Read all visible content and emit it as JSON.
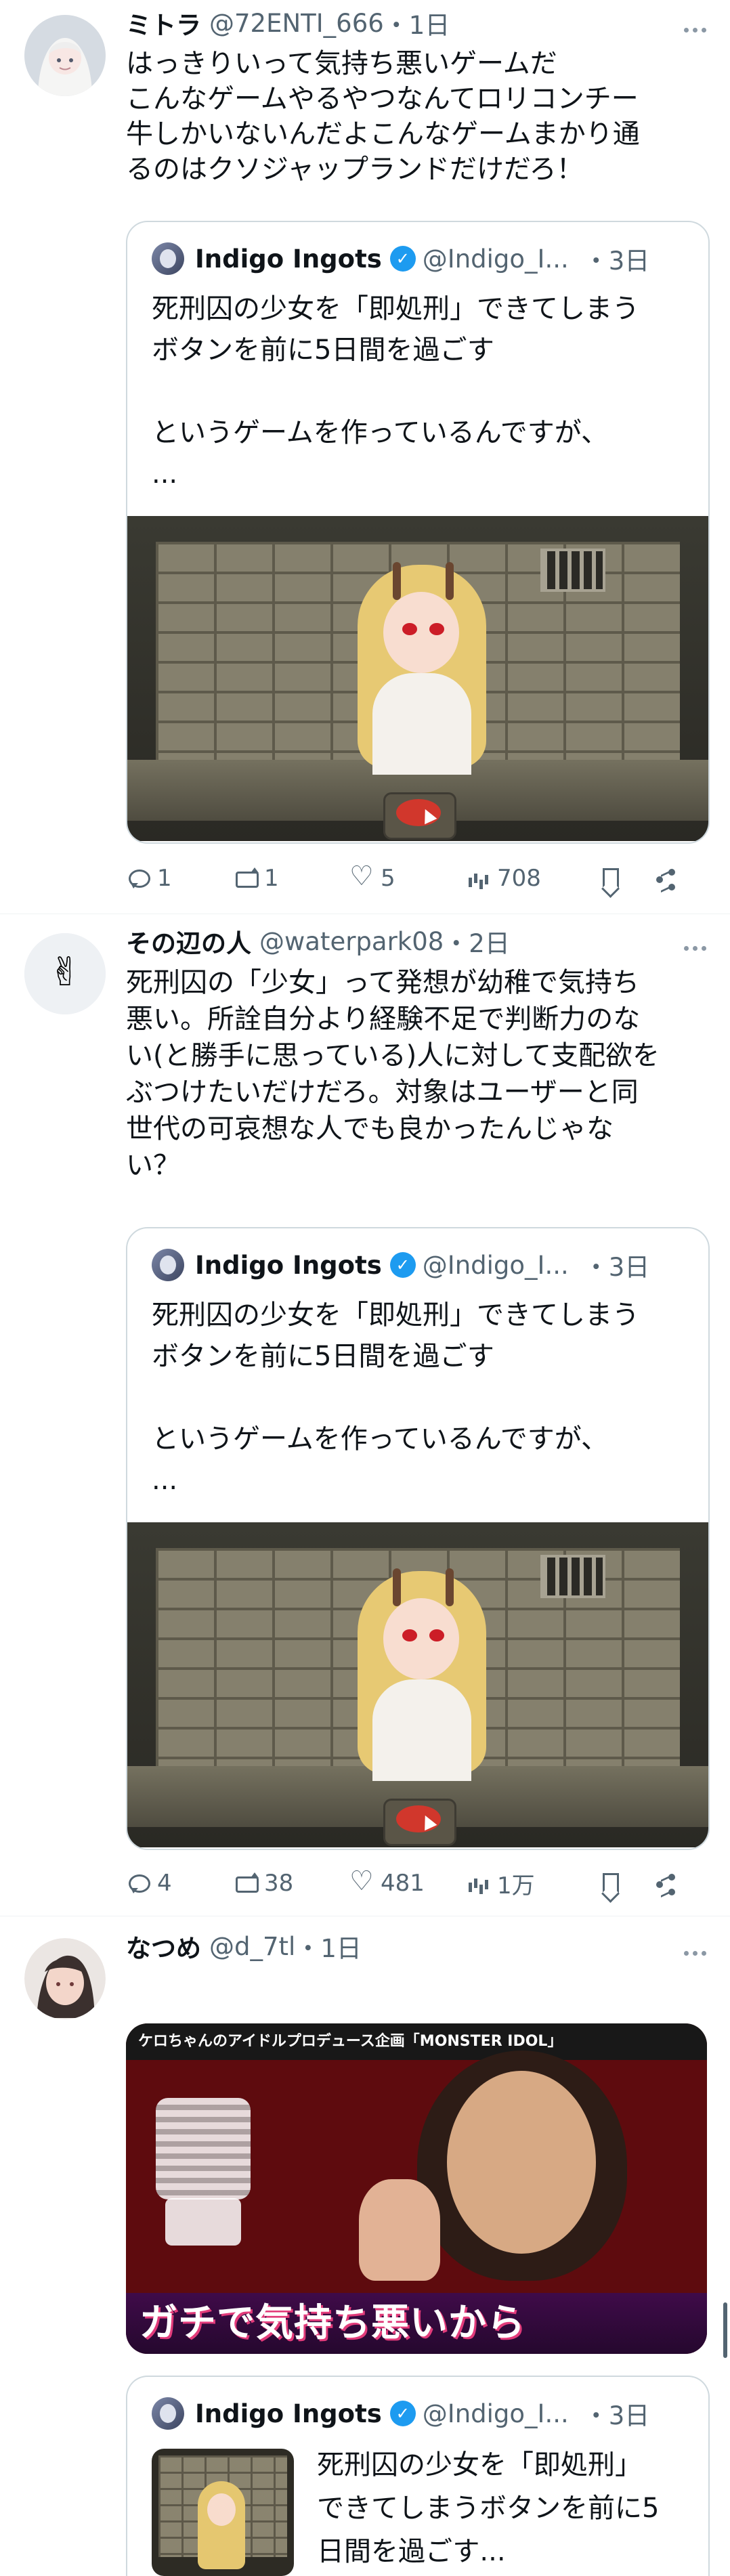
{
  "tweets": [
    {
      "name": "ミトラ",
      "handle": "@72ENTI_666",
      "time": "・1日",
      "text": "はっきりいって気持ち悪いゲームだ\nこんなゲームやるやつなんてロリコンチー\n牛しかいないんだよこんなゲームまかり通\nるのはクソジャップランドだけだろ！",
      "quote": {
        "name": "Indigo Ingots",
        "handle": "@Indigo_I...",
        "time": "・3日",
        "text": "死刑囚の少女を「即処刑」できてしまう\nボタンを前に5日間を過ごす\n\nというゲームを作っているんですが、\n..."
      },
      "stats": {
        "replies": "1",
        "retweets": "1",
        "likes": "5",
        "views": "708"
      }
    },
    {
      "name": "その辺の人",
      "handle": "@waterpark08",
      "time": "・2日",
      "text": "死刑囚の「少女」って発想が幼稚で気持ち\n悪い。所詮自分より経験不足で判断力のな\nい(と勝手に思っている)人に対して支配欲を\nぶつけたいだけだろ。対象はユーザーと同\n世代の可哀想な人でも良かったんじゃな\nい？",
      "quote": {
        "name": "Indigo Ingots",
        "handle": "@Indigo_I...",
        "time": "・3日",
        "text": "死刑囚の少女を「即処刑」できてしまう\nボタンを前に5日間を過ごす\n\nというゲームを作っているんですが、\n..."
      },
      "stats": {
        "replies": "4",
        "retweets": "38",
        "likes": "481",
        "views": "1万"
      }
    },
    {
      "name": "なつめ",
      "handle": "@d_7tl",
      "time": "・1日",
      "media": {
        "top_caption": "ケロちゃんのアイドルプロデュース企画「MONSTER IDOL」",
        "caption": "ガチで気持ち悪いから"
      },
      "quote": {
        "name": "Indigo Ingots",
        "handle": "@Indigo_I...",
        "time": "・3日",
        "text": "死刑囚の少女を「即処刑」\nできてしまうボタンを前に5\n日間を過ごす..."
      }
    }
  ],
  "colors": {
    "text": "#0f1419",
    "secondary": "#536471",
    "border": "#cfd9de",
    "verified": "#1d9bf0"
  },
  "icons": [
    "reply-icon",
    "retweet-icon",
    "like-icon",
    "view-icon",
    "bookmark-icon",
    "share-icon",
    "more-icon",
    "verified-icon"
  ]
}
